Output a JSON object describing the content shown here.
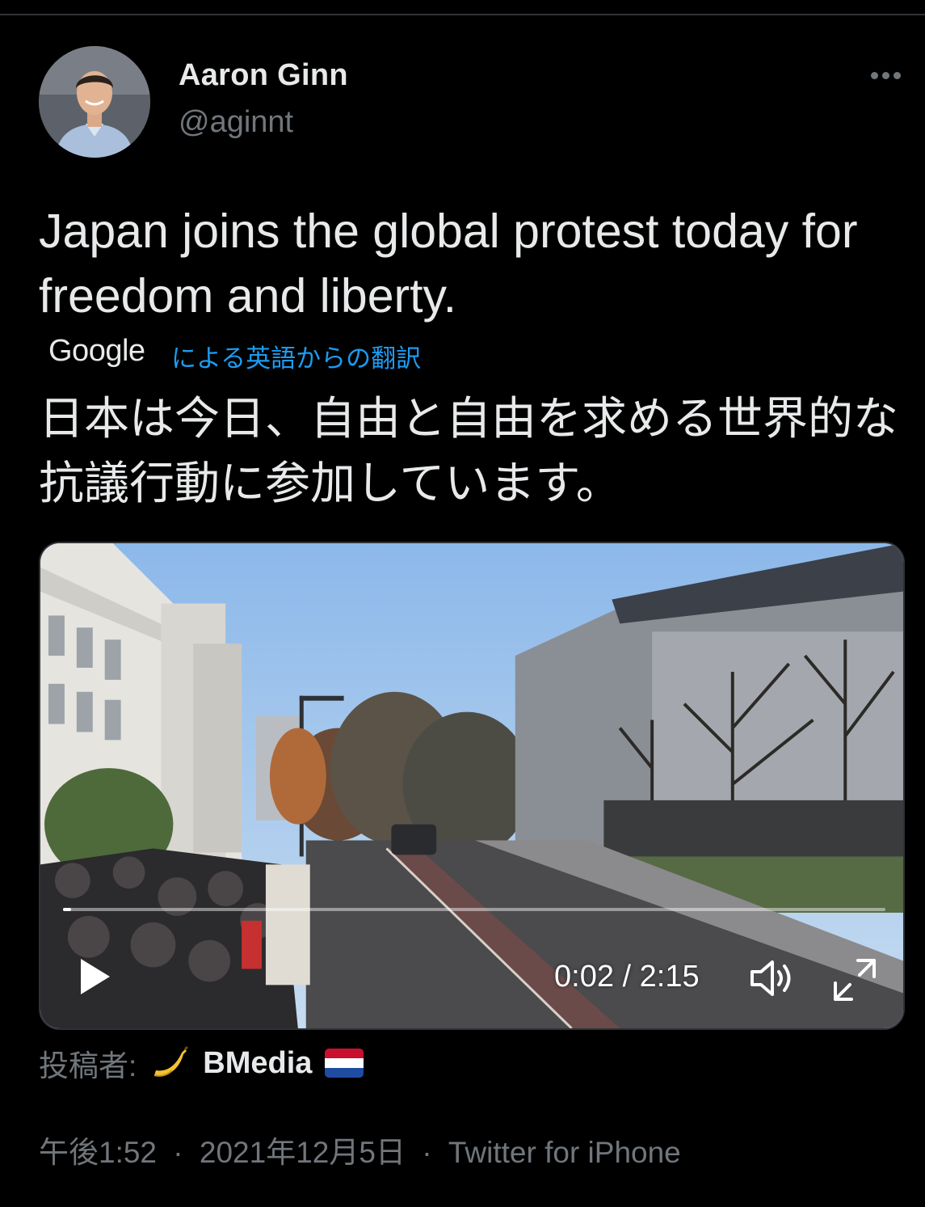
{
  "author": {
    "name": "Aaron Ginn",
    "handle": "@aginnt"
  },
  "tweet": {
    "text": "Japan joins the global protest today for freedom and liberty.",
    "translation_provider": "Google",
    "translation_label": "による英語からの翻訳",
    "translated_text": "日本は今日、自由と自由を求める世界的な抗議行動に参加しています。"
  },
  "video": {
    "time_display": "0:02 / 2:15",
    "progress": 0.01,
    "controls": [
      "play-icon",
      "volume-icon",
      "fullscreen-icon"
    ]
  },
  "attribution": {
    "label": "投稿者:",
    "icon": "banana-icon",
    "name": "BMedia",
    "flag": "netherlands-flag-icon"
  },
  "meta": {
    "time": "午後1:52",
    "separator": "·",
    "date": "2021年12月5日",
    "source": "Twitter for iPhone"
  },
  "colors": {
    "background": "#000000",
    "text": "#e7e9ea",
    "secondary": "#71767b",
    "link": "#1d9bf0"
  }
}
